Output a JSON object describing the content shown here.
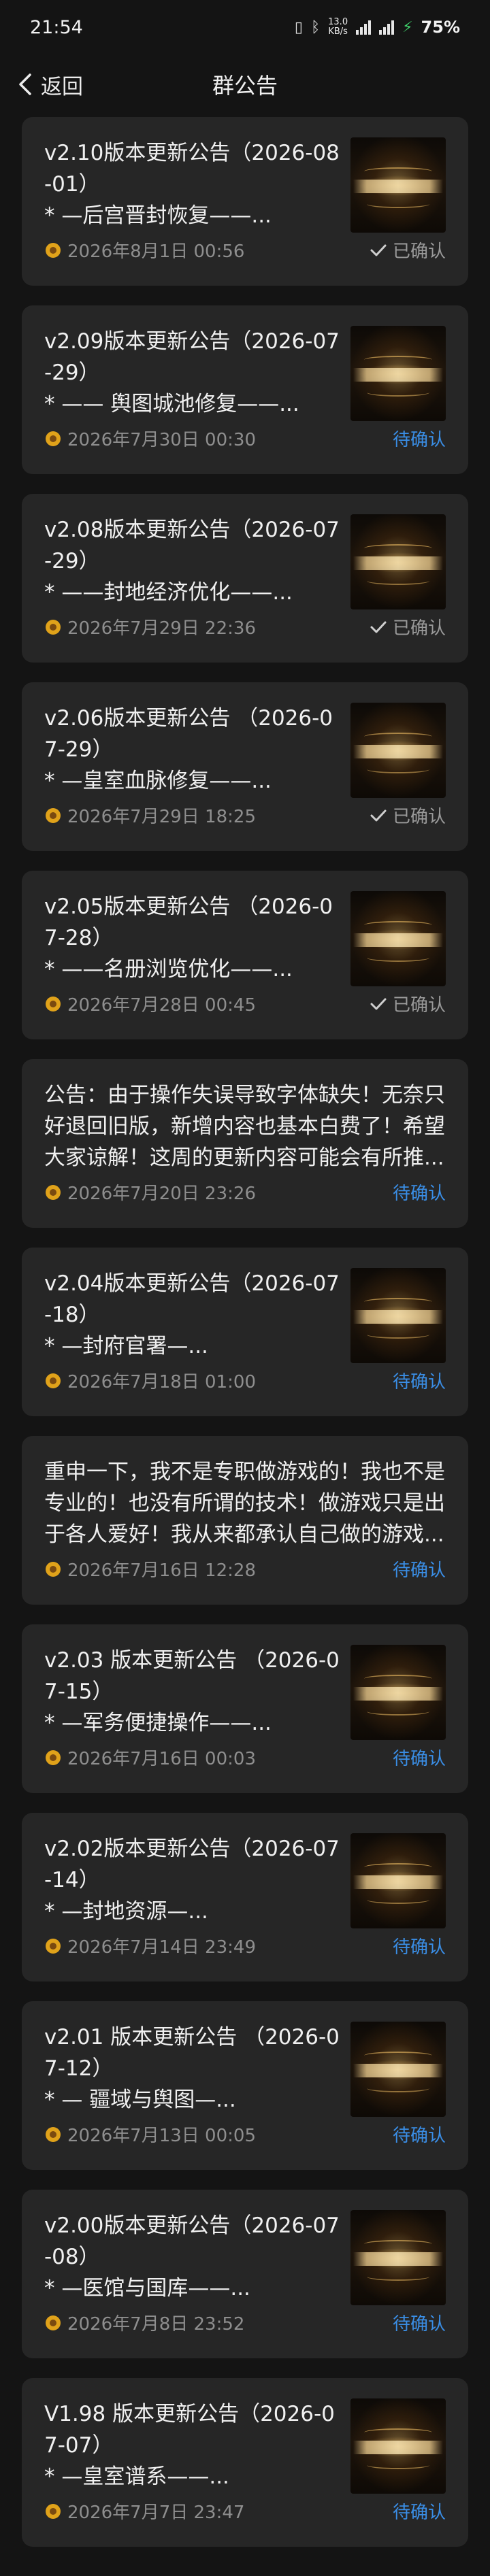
{
  "status_bar": {
    "time": "21:54",
    "net_speed_value": "13.0",
    "net_speed_unit": "KB/s",
    "battery": "75%"
  },
  "nav": {
    "back_label": "返回",
    "title": "群公告"
  },
  "colors": {
    "background": "#141414",
    "card": "#262626",
    "pending": "#3a8ee6",
    "confirmed": "#9a9a9a"
  },
  "announcements": [
    {
      "title": "v2.10版本更新公告（2026-08-01）",
      "excerpt": "* —后宫晋封恢复——...",
      "time": "2026年8月1日 00:56",
      "status": "已确认",
      "confirmed": true,
      "has_image": true
    },
    {
      "title": "v2.09版本更新公告（2026-07-29）",
      "excerpt": "* —— 舆图城池修复——...",
      "time": "2026年7月30日 00:30",
      "status": "待确认",
      "confirmed": false,
      "has_image": true
    },
    {
      "title": "v2.08版本更新公告（2026-07-29）",
      "excerpt": "* ——封地经济优化——...",
      "time": "2026年7月29日 22:36",
      "status": "已确认",
      "confirmed": true,
      "has_image": true
    },
    {
      "title": "v2.06版本更新公告 （2026-07-29）",
      "excerpt": "* —皇室血脉修复——...",
      "time": "2026年7月29日 18:25",
      "status": "已确认",
      "confirmed": true,
      "has_image": true
    },
    {
      "title": "v2.05版本更新公告 （2026-07-28）",
      "excerpt": "* ——名册浏览优化——...",
      "time": "2026年7月28日 00:45",
      "status": "已确认",
      "confirmed": true,
      "has_image": true
    },
    {
      "title": "公告：由于操作失误导致字体缺失！无奈只好退回旧版，新增内容也基本白费了！希望大家谅解！这周的更新内容可能会有所推...",
      "excerpt": "",
      "time": "2026年7月20日 23:26",
      "status": "待确认",
      "confirmed": false,
      "has_image": false
    },
    {
      "title": "v2.04版本更新公告（2026-07-18）",
      "excerpt": "* —封府官署—...",
      "time": "2026年7月18日 01:00",
      "status": "待确认",
      "confirmed": false,
      "has_image": true
    },
    {
      "title": "重申一下，我不是专职做游戏的！我也不是专业的！也没有所谓的技术！做游戏只是出于各人爱好！我从来都承认自己做的游戏...",
      "excerpt": "",
      "time": "2026年7月16日 12:28",
      "status": "待确认",
      "confirmed": false,
      "has_image": false
    },
    {
      "title": "v2.03 版本更新公告 （2026-07-15）",
      "excerpt": "* —军务便捷操作——...",
      "time": "2026年7月16日 00:03",
      "status": "待确认",
      "confirmed": false,
      "has_image": true
    },
    {
      "title": "v2.02版本更新公告（2026-07-14）",
      "excerpt": "* —封地资源—...",
      "time": "2026年7月14日 23:49",
      "status": "待确认",
      "confirmed": false,
      "has_image": true
    },
    {
      "title": "v2.01 版本更新公告 （2026-07-12）",
      "excerpt": "* — 疆域与舆图—...",
      "time": "2026年7月13日 00:05",
      "status": "待确认",
      "confirmed": false,
      "has_image": true
    },
    {
      "title": "v2.00版本更新公告（2026-07-08）",
      "excerpt": "* —医馆与国库——...",
      "time": "2026年7月8日 23:52",
      "status": "待确认",
      "confirmed": false,
      "has_image": true
    },
    {
      "title": "V1.98 版本更新公告（2026-07-07）",
      "excerpt": "* —皇室谱系——...",
      "time": "2026年7月7日 23:47",
      "status": "待确认",
      "confirmed": false,
      "has_image": true
    }
  ]
}
